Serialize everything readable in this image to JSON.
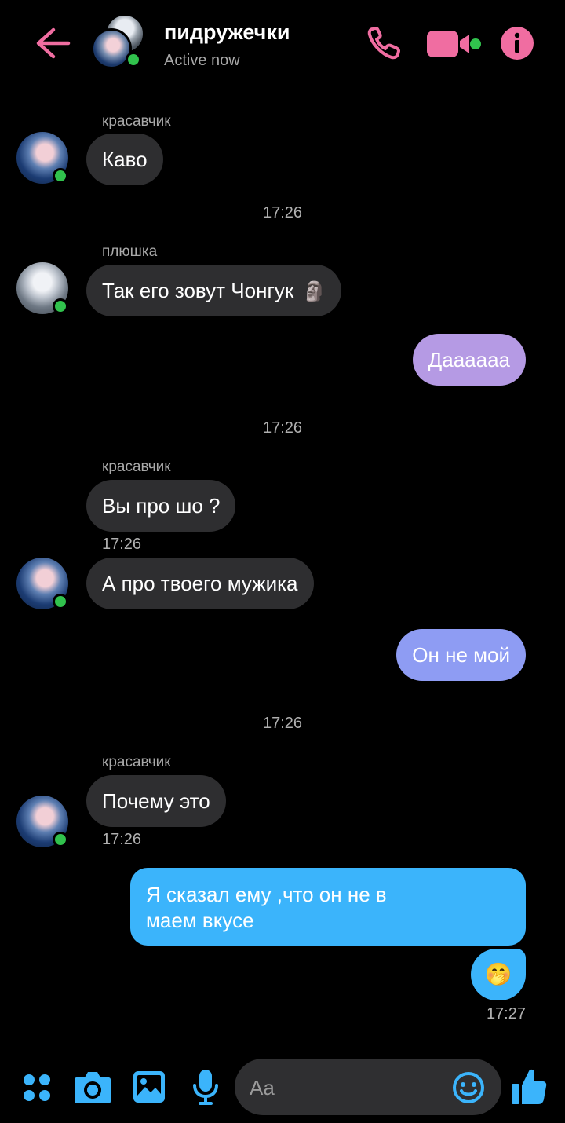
{
  "header": {
    "title": "пидружечки",
    "status": "Active now",
    "colors": {
      "accent": "#f06da1",
      "online": "#31c24d"
    }
  },
  "messages": {
    "m1": {
      "sender": "красавчик",
      "text": "Каво"
    },
    "ts1": "17:26",
    "m2": {
      "sender": "плюшка",
      "text": "Так его зовут Чонгук",
      "emoji": "🗿"
    },
    "m3": {
      "text": "Даааааа"
    },
    "ts2": "17:26",
    "m4": {
      "sender": "красавчик",
      "text": "Вы про шо ?",
      "time": "17:26"
    },
    "m5": {
      "text": "А про твоего мужика"
    },
    "m6": {
      "text": "Он не мой"
    },
    "ts3": "17:26",
    "m7": {
      "sender": "красавчик",
      "text": "Почему это",
      "time": "17:26"
    },
    "m8": {
      "line1": "Я сказал ему ,что он не в",
      "line2": "маем вкусе"
    },
    "m9": {
      "emoji": "🤭",
      "time": "17:27"
    }
  },
  "composer": {
    "placeholder": "Aa"
  },
  "icons": [
    "back-arrow-icon",
    "phone-icon",
    "video-icon",
    "info-icon",
    "apps-icon",
    "camera-icon",
    "gallery-icon",
    "microphone-icon",
    "emoji-icon",
    "thumbs-up-icon"
  ]
}
